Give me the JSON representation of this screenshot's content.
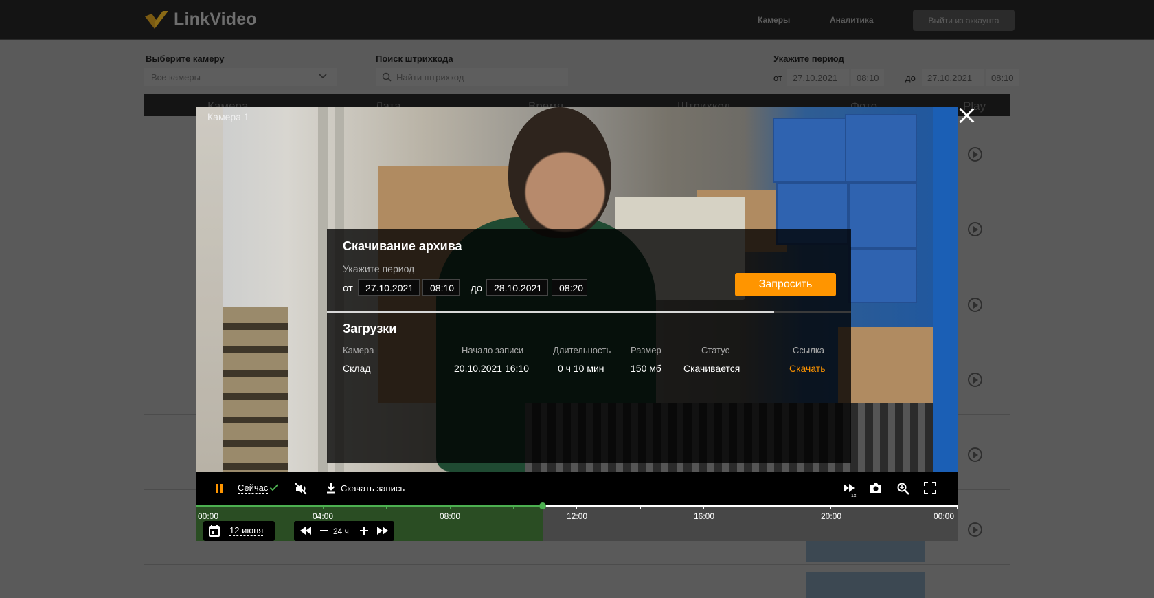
{
  "app": {
    "logo_text": "LinkVideo",
    "accent_color": "#ff9500",
    "progress_color": "#4caf50"
  },
  "header": {
    "nav": [
      {
        "label": "Камеры"
      },
      {
        "label": "Аналитика"
      }
    ],
    "logout_label": "Выйти из аккаунта"
  },
  "filters": {
    "camera_label": "Выберите камеру",
    "camera_value": "Все камеры",
    "barcode_label": "Поиск штрихкода",
    "barcode_placeholder": "Найти штрихкод",
    "period_label": "Укажите период",
    "from_label": "от",
    "to_label": "до",
    "from_date": "27.10.2021",
    "from_time": "08:10",
    "to_date": "27.10.2021",
    "to_time": "08:10"
  },
  "table": {
    "headers": [
      "Камера",
      "Дата",
      "Время",
      "Штрихкод",
      "Фото",
      "Play"
    ]
  },
  "player": {
    "camera_title": "Камера 1",
    "download_panel": {
      "title": "Скачивание архива",
      "period_label": "Укажите период",
      "from_label": "от",
      "to_label": "до",
      "from_date": "27.10.2021",
      "from_time": "08:10",
      "to_date": "28.10.2021",
      "to_time": "08:20",
      "request_label": "Запросить",
      "downloads_title": "Загрузки",
      "columns": [
        "Камера",
        "Начало записи",
        "Длительность",
        "Размер",
        "Статус",
        "Ссылка"
      ],
      "rows": [
        {
          "camera": "Склад",
          "start": "20.10.2021 16:10",
          "duration": "0 ч 10 мин",
          "size": "150 мб",
          "status": "Скачивается",
          "link": "Скачать"
        }
      ]
    },
    "controls": {
      "now_label": "Сейчас",
      "download_record_label": "Скачать запись",
      "speed_label": "1x",
      "icons": [
        "pause-icon",
        "check-icon",
        "mute-icon",
        "download-icon",
        "fast-forward-icon",
        "camera-icon",
        "zoom-in-icon",
        "fullscreen-icon"
      ]
    },
    "timeline": {
      "labels": [
        "00:00",
        "04:00",
        "08:00",
        "12:00",
        "16:00",
        "20:00",
        "00:00"
      ],
      "played_fraction": 0.455,
      "date_label": "12 июня",
      "zoom_label": "24 ч"
    }
  }
}
